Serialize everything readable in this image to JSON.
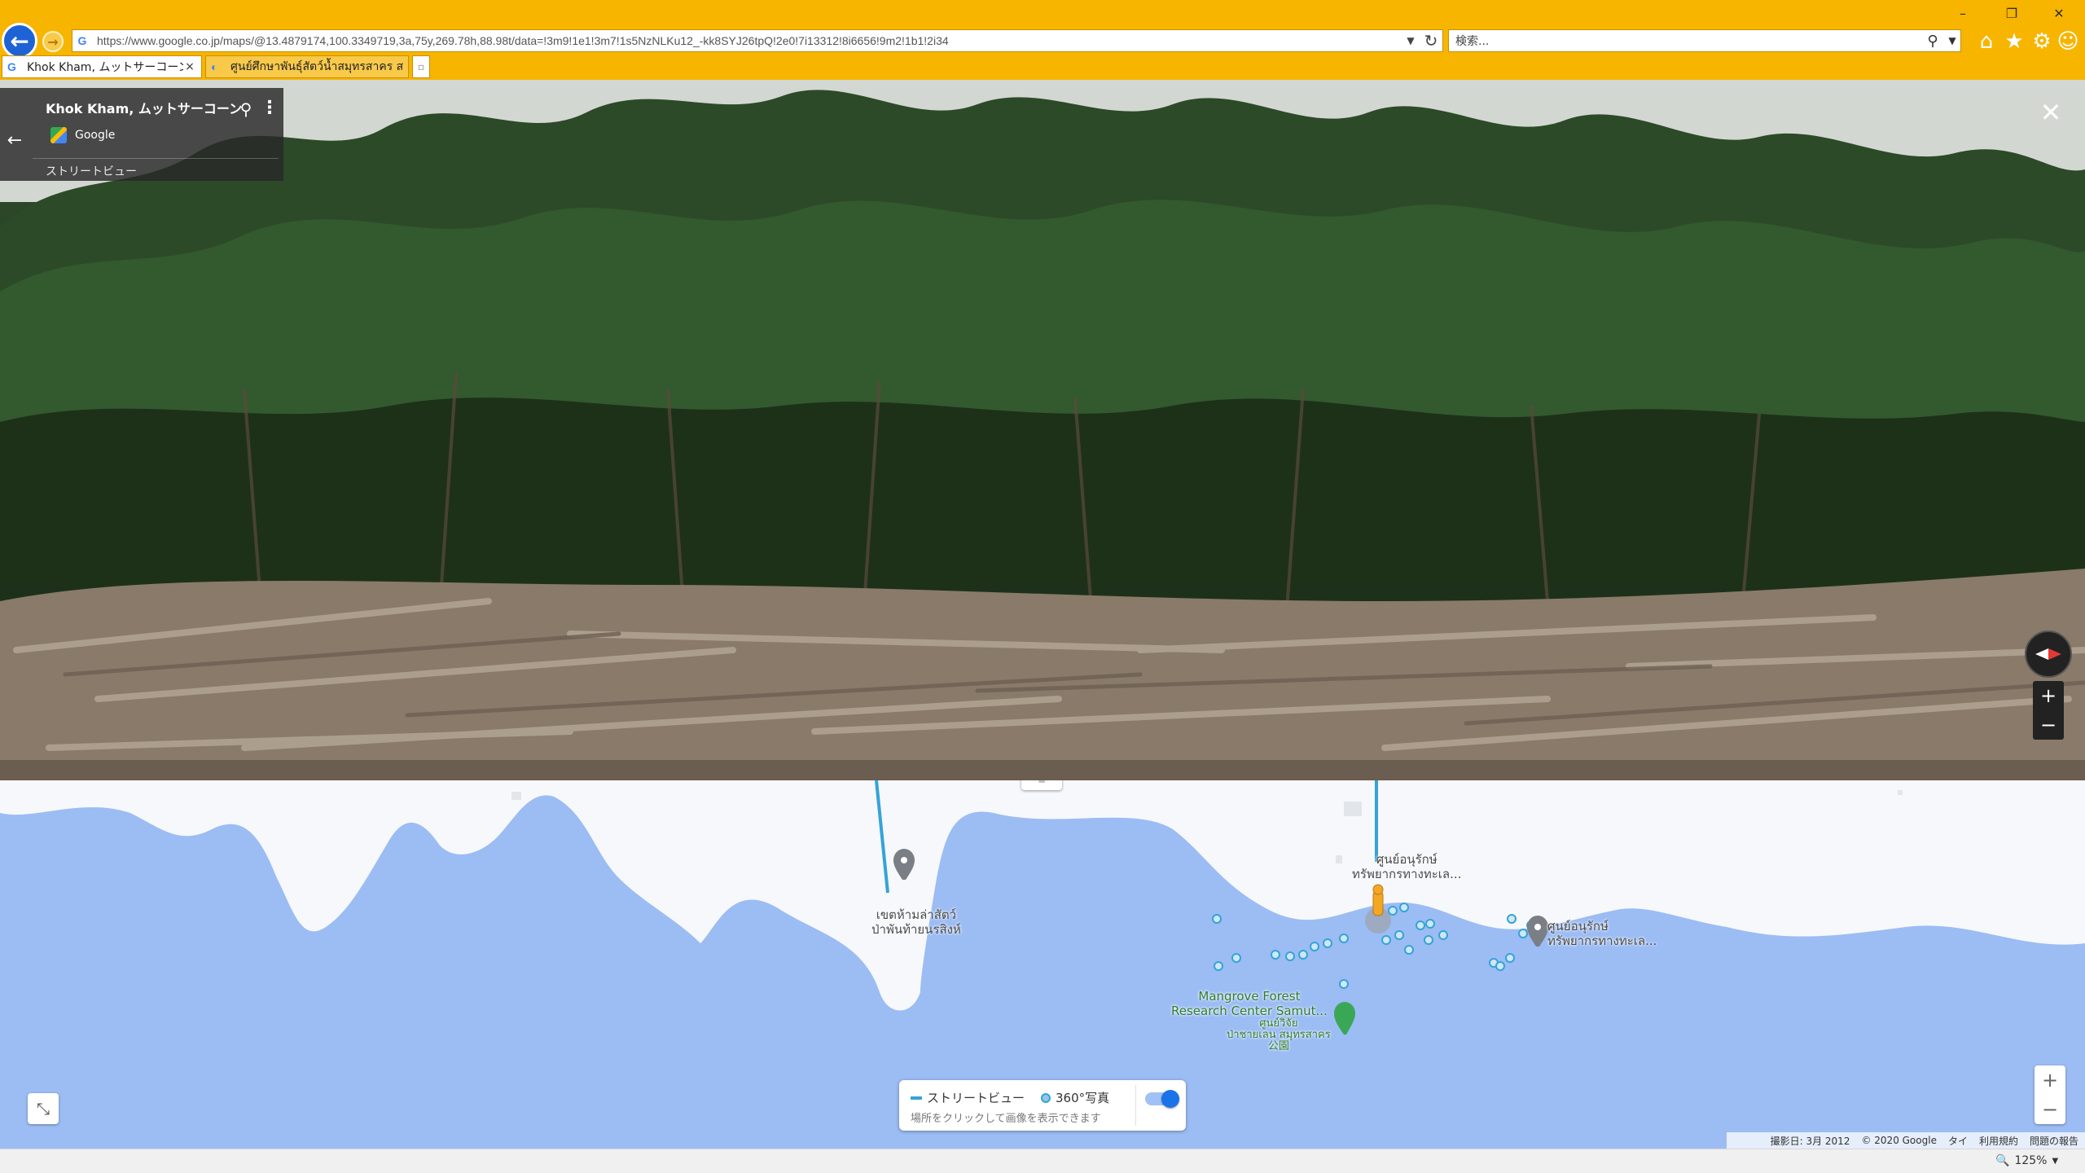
{
  "browser": {
    "address_url": "https://www.google.co.jp/maps/@13.4879174,100.3349719,3a,75y,269.78h,88.98t/data=!3m9!1e1!3m7!1s5NzNLKu12_-kk8SYJ26tpQ!2e0!7i13312!8i6656!9m2!1b1!2i34",
    "search_placeholder": "検索...",
    "tabs": [
      {
        "title": "Khok Kham, ムットサーコーン - ...",
        "favicon": "G",
        "close": "×"
      },
      {
        "title": "ศูนย์ศึกษาพันธุ์สัตว์น้ำสมุทรสาคร สม...",
        "favicon": "◐"
      }
    ],
    "back_icon": "←",
    "forward_icon": "→",
    "home_icon": "⌂",
    "favorites_icon": "★",
    "settings_icon": "⚙",
    "feedback_icon": "☺",
    "window_controls": {
      "minimize": "–",
      "restore": "❐",
      "close": "✕"
    }
  },
  "street_view": {
    "title": "Khok Kham, ムットサーコーン",
    "brand": "Google",
    "label": "ストリートビュー",
    "back_icon": "←",
    "pin_icon": "⚲",
    "more_icon": "⋮",
    "close_icon": "✕",
    "zoom_in": "+",
    "zoom_out": "−"
  },
  "map": {
    "labels": {
      "sanctuary": "เขตห้ามล่าสัตว์\nป่าพันท้ายนรสิงห์",
      "center_top": "ศูนย์อนุรักษ์\nทรัพยากรทางทะเล...",
      "center_right": "ศูนย์อนุรักษ์\nทรัพยากรทางทะเล...",
      "mangrove": "Mangrove Forest\nResearch Center Samut...",
      "park": "ศูนย์วิจัย\nป่าชายเลน สมุทรสาคร\n公園"
    },
    "drag_handle": "═",
    "collapse_icon": "⤡",
    "zoom_in": "+",
    "zoom_out": "−",
    "legend": {
      "streetview": "ストリートビュー",
      "photos_360": "360°写真",
      "hint": "場所をクリックして画像を表示できます",
      "toggle_on": true
    },
    "footer": {
      "date": "撮影日: 3月 2012",
      "copyright": "© 2020 Google",
      "country": "タイ",
      "terms": "利用規約",
      "report": "問題の報告"
    }
  },
  "status_bar": {
    "zoom_level": "125%",
    "zoom_icon": "🔍",
    "dropdown": "▼"
  },
  "colors": {
    "browser_chrome": "#f7b500",
    "map_water": "#9cbcf4",
    "map_land": "#f6f8fb",
    "streetview_blue": "#35a3d8",
    "accent_blue": "#1a73e8"
  }
}
